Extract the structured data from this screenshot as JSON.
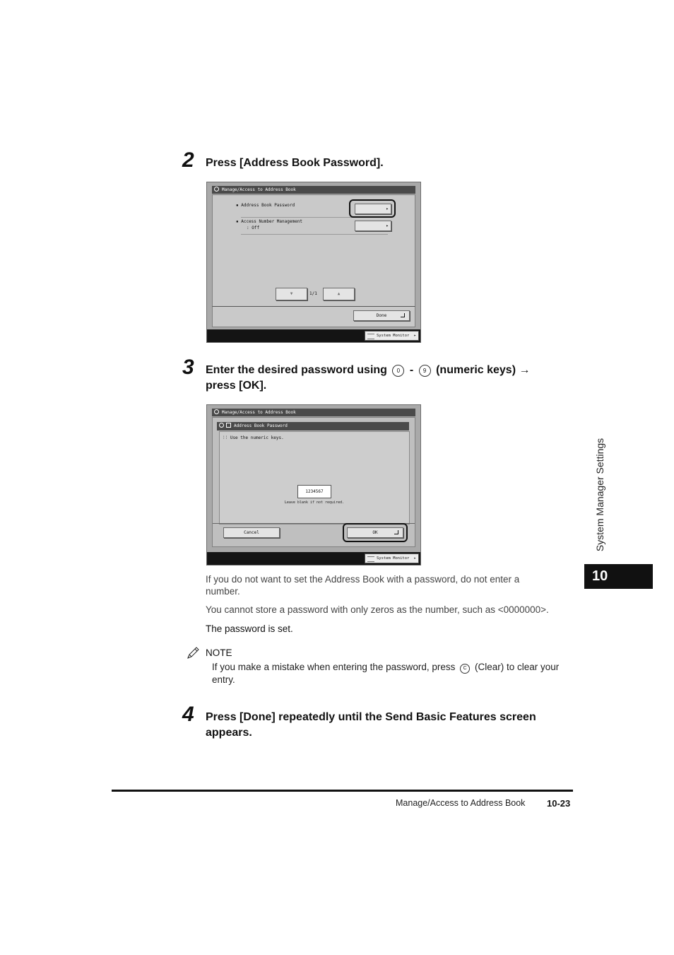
{
  "steps": {
    "s2": {
      "num": "2",
      "text": "Press [Address Book Password]."
    },
    "s3": {
      "num": "3",
      "text_a": "Enter the desired password using",
      "key0": "0",
      "dash": "-",
      "key9": "9",
      "text_b": "(numeric keys) →",
      "text_c": "press [OK]."
    },
    "s4": {
      "num": "4",
      "line1": "Press [Done] repeatedly until the Send Basic Features screen",
      "line2": "appears."
    }
  },
  "screen1": {
    "title": "Manage/Access to Address Book",
    "items": [
      {
        "label": "Address Book Password",
        "sub": ""
      },
      {
        "label": "Access Number Management",
        "sub": ": Off"
      }
    ],
    "page": "1/1",
    "done": "Done",
    "system_monitor": "System Monitor"
  },
  "screen2": {
    "title": "Manage/Access to Address Book",
    "dialog_title": "Address Book Password",
    "instruction": "Use the numeric keys.",
    "value": "1234567",
    "hint": "Leave blank if not required.",
    "cancel": "Cancel",
    "ok": "OK",
    "system_monitor": "System Monitor"
  },
  "notes": {
    "p1_line1": "If you do not want to set the Address Book with a password, do not enter a",
    "p1_line2": "number.",
    "p2": "You cannot store a password with only zeros as the number, such as <0000000>.",
    "p3": "The password is set."
  },
  "note_box": {
    "label": "NOTE",
    "line1_a": "If you make a mistake when entering the password, press",
    "clear_key": "C",
    "line1_b": "(Clear) to clear your",
    "line2": "entry."
  },
  "side": {
    "label": "System Manager Settings",
    "chapter": "10"
  },
  "footer": {
    "section": "Manage/Access to Address Book",
    "page": "10-23"
  }
}
